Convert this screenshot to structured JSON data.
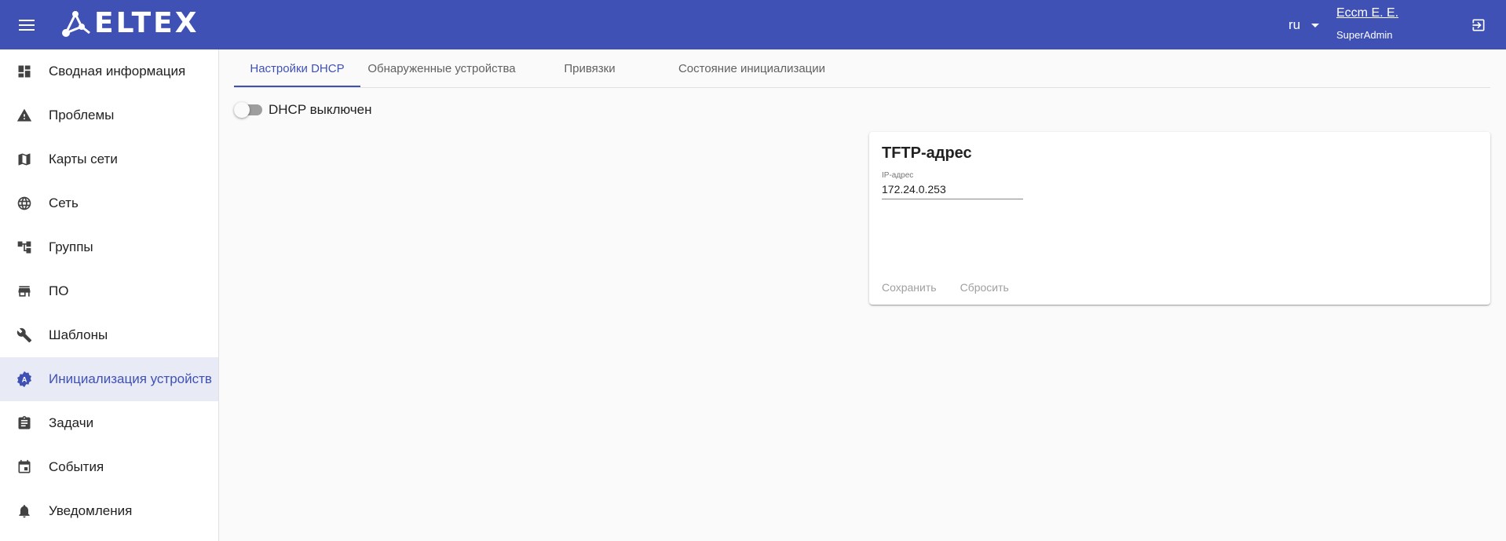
{
  "header": {
    "logo_text": "ELTEX",
    "language": "ru",
    "user_name": "Еccm E. E.",
    "user_role": "SuperAdmin"
  },
  "sidebar": {
    "items": [
      {
        "label": "Сводная информация",
        "icon": "dashboard-icon"
      },
      {
        "label": "Проблемы",
        "icon": "warning-icon"
      },
      {
        "label": "Карты сети",
        "icon": "map-icon"
      },
      {
        "label": "Сеть",
        "icon": "globe-icon"
      },
      {
        "label": "Группы",
        "icon": "hierarchy-icon"
      },
      {
        "label": "ПО",
        "icon": "store-icon"
      },
      {
        "label": "Шаблоны",
        "icon": "wrench-icon"
      },
      {
        "label": "Инициализация устройств",
        "icon": "settings-badge-icon",
        "active": true
      },
      {
        "label": "Задачи",
        "icon": "clipboard-icon"
      },
      {
        "label": "События",
        "icon": "calendar-icon"
      },
      {
        "label": "Уведомления",
        "icon": "bell-icon"
      }
    ]
  },
  "tabs": [
    {
      "label": "Настройки DHCP",
      "active": true
    },
    {
      "label": "Обнаруженные устройства"
    },
    {
      "label": "Привязки"
    },
    {
      "label": "Состояние инициализации"
    }
  ],
  "dhcp_toggle": {
    "label": "DHCP выключен",
    "enabled": false
  },
  "tftp_card": {
    "title": "TFTP-адрес",
    "field_label": "IP-адрес",
    "field_value": "172.24.0.253",
    "save_label": "Сохранить",
    "reset_label": "Сбросить"
  },
  "colors": {
    "primary": "#3f51b5",
    "active_bg": "#e8eaf6",
    "disabled_text": "#a0a0a0"
  }
}
